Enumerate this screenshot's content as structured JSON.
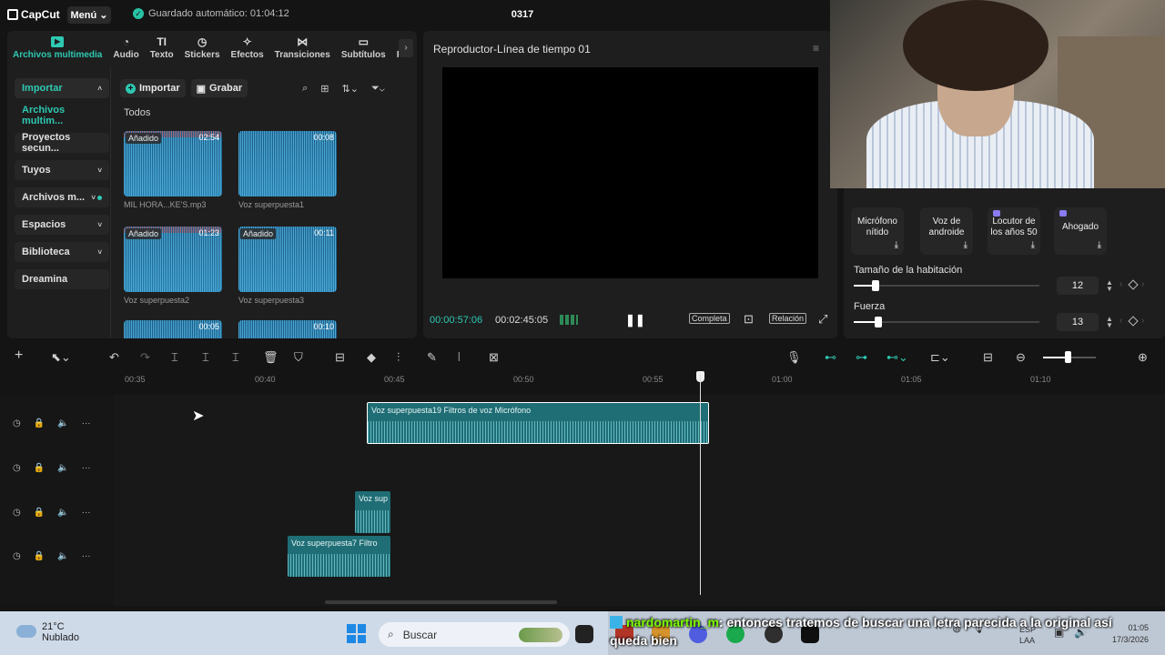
{
  "app": {
    "logo": "CapCut",
    "menu_label": "Menú",
    "autosave": "Guardado automático: 01:04:12",
    "project_name": "0317"
  },
  "media_tabs": [
    {
      "icon": "media-icon",
      "label": "Archivos multimedia"
    },
    {
      "icon": "audio-icon",
      "label": "Audio"
    },
    {
      "icon": "text-icon",
      "label": "Texto"
    },
    {
      "icon": "sticker-icon",
      "label": "Stickers"
    },
    {
      "icon": "effects-icon",
      "label": "Efectos"
    },
    {
      "icon": "transitions-icon",
      "label": "Transiciones"
    },
    {
      "icon": "subtitles-icon",
      "label": "Subtítulos"
    },
    {
      "icon": "filters-icon",
      "label": "Filt"
    }
  ],
  "media_sidebar": [
    {
      "label": "Importar",
      "state": "hl",
      "chev": "˄"
    },
    {
      "label": "Archivos multim...",
      "state": "plain",
      "chev": ""
    },
    {
      "label": "Proyectos secun...",
      "state": "",
      "chev": ""
    },
    {
      "label": "Tuyos",
      "state": "",
      "chev": "˅"
    },
    {
      "label": "Archivos m...",
      "state": "",
      "chev": "˅"
    },
    {
      "label": "Espacios",
      "state": "",
      "chev": "˅"
    },
    {
      "label": "Biblioteca",
      "state": "",
      "chev": "˅"
    },
    {
      "label": "Dreamina",
      "state": "",
      "chev": ""
    }
  ],
  "media_toolbar": {
    "import_label": "Importar",
    "record_label": "Grabar"
  },
  "media_section_label": "Todos",
  "media_items": [
    {
      "name": "MIL HORA...KE'S.mp3",
      "duration": "02:54",
      "badge": "Añadido"
    },
    {
      "name": "Voz superpuesta1",
      "duration": "00:08",
      "badge": ""
    },
    {
      "name": "Voz superpuesta2",
      "duration": "01:23",
      "badge": "Añadido"
    },
    {
      "name": "Voz superpuesta3",
      "duration": "00:11",
      "badge": "Añadido"
    },
    {
      "name": "",
      "duration": "00:05",
      "badge": ""
    },
    {
      "name": "",
      "duration": "00:10",
      "badge": ""
    }
  ],
  "player": {
    "title": "Reproductor-Línea de tiempo 01",
    "current_time": "00:00:57:06",
    "total_time": "00:02:45:05",
    "btn_full": "Completa",
    "btn_ratio": "Relación"
  },
  "voice_panel": {
    "cards": [
      {
        "label": "Micrófono nítido",
        "premium": false
      },
      {
        "label": "Voz de androide",
        "premium": false
      },
      {
        "label": "Locutor de los años 50",
        "premium": true
      },
      {
        "label": "Ahogado",
        "premium": true
      }
    ],
    "room_size": {
      "label": "Tamaño de la habitación",
      "value": "12",
      "level": 0.12
    },
    "strength": {
      "label": "Fuerza",
      "value": "13",
      "level": 0.13
    }
  },
  "timeline": {
    "ruler_ticks": [
      "00:35",
      "00:40",
      "00:45",
      "00:50",
      "00:55",
      "01:00",
      "01:05",
      "01:10"
    ],
    "clips": [
      {
        "label": "Voz superpuesta19   Filtros de voz Micrófono",
        "track": 0
      },
      {
        "label": "Voz sup",
        "track": 2
      },
      {
        "label": "Voz superpuesta7   Filtro",
        "track": 3
      }
    ]
  },
  "taskbar": {
    "temp": "21°C",
    "weather": "Nublado",
    "search_placeholder": "Buscar",
    "lang1": "ESP",
    "lang2": "LAA",
    "time": "01:05",
    "date": "17/3/2026"
  },
  "chat": {
    "user": "nardomartin_m",
    "message": ": entonces tratemos de buscar una letra parecida a la original así",
    "line2": "queda bien"
  }
}
